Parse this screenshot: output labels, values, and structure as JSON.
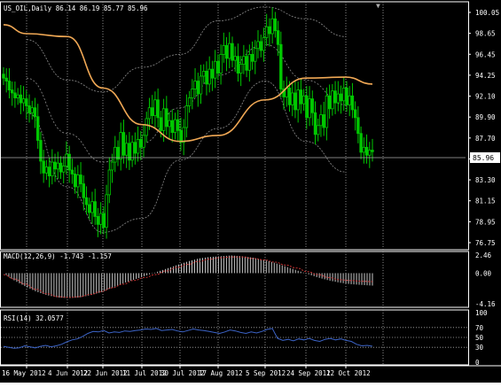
{
  "symbol_header": "US_OIL,Daily  86.14 86.19 85.77 85.96",
  "colors": {
    "background": "#000000",
    "frame": "#ffffff",
    "bull": "#00c800",
    "bear": "#00c800",
    "ma": "#f0a855",
    "bands": "#8c8c8c",
    "grid": "#aaaaaa",
    "macd_hist": "#c8c8c8",
    "macd_signal": "#c83232",
    "rsi": "#3c64c8",
    "text": "#ffffff",
    "price_tag_bg": "#ffffff",
    "price_tag_text": "#000000"
  },
  "price_axis_labels": [
    "100.05",
    "98.65",
    "96.45",
    "94.25",
    "92.10",
    "89.90",
    "87.70",
    "85.50",
    "83.30",
    "81.15",
    "78.95",
    "76.75"
  ],
  "current_price_tag": "85.96",
  "macd_title": "MACD(12,26,9) -1.743 -1.157",
  "macd_axis_labels": [
    "2.46",
    "0.00",
    "-4.16"
  ],
  "rsi_title": "RSI(14) 32.0577",
  "rsi_axis_labels": [
    "100",
    "70",
    "50",
    "30",
    "0"
  ],
  "date_labels": [
    "16 May 2012",
    "4 Jun 2012",
    "22 Jun 2012",
    "11 Jul 2012",
    "30 Jul 2012",
    "17 Aug 2012",
    "5 Sep 2012",
    "24 Sep 2012",
    "12 Oct 2012"
  ],
  "chart_data": [
    {
      "type": "candlestick",
      "title": "US_OIL,Daily",
      "ohlc_last": {
        "open": 86.14,
        "high": 86.19,
        "low": 85.77,
        "close": 85.96
      },
      "ylim": [
        76.75,
        100.05
      ],
      "x_tick_labels": [
        "16 May 2012",
        "4 Jun 2012",
        "22 Jun 2012",
        "11 Jul 2012",
        "30 Jul 2012",
        "17 Aug 2012",
        "5 Sep 2012",
        "24 Sep 2012",
        "12 Oct 2012"
      ],
      "close_series": [
        93.4,
        93.1,
        92.2,
        91.9,
        91.4,
        91.7,
        90.9,
        91.3,
        90.6,
        89.9,
        90.4,
        89.5,
        87.1,
        85.0,
        83.8,
        84.4,
        83.5,
        84.9,
        84.2,
        84.8,
        83.9,
        84.5,
        85.7,
        84.1,
        83.7,
        82.4,
        83.6,
        82.7,
        81.3,
        80.6,
        79.8,
        80.9,
        79.4,
        78.6,
        79.7,
        78.3,
        81.6,
        84.1,
        84.9,
        86.4,
        85.2,
        87.9,
        85.6,
        86.8,
        85.1,
        86.9,
        85.8,
        87.2,
        86.4,
        87.6,
        89.3,
        90.4,
        89.6,
        91.2,
        89.4,
        88.1,
        90.3,
        88.5,
        89.1,
        87.9,
        89.2,
        88.1,
        86.9,
        88.4,
        90.6,
        91.4,
        92.3,
        93.1,
        91.8,
        93.6,
        94.1,
        92.8,
        94.3,
        93.4,
        95.1,
        93.9,
        95.8,
        96.7,
        95.4,
        96.9,
        95.2,
        95.6,
        93.9,
        94.8,
        95.6,
        94.2,
        95.8,
        95.1,
        96.4,
        97.1,
        96.2,
        97.5,
        98.6,
        97.9,
        99.4,
        98.2,
        96.8,
        92.3,
        91.5,
        92.4,
        90.7,
        91.9,
        90.2,
        92.2,
        90.8,
        91.6,
        89.4,
        91.3,
        89.9,
        87.7,
        88.6,
        89.7,
        88.4,
        91.6,
        90.3,
        92.1,
        90.9,
        91.8,
        91.1,
        92.4,
        90.7,
        91.6,
        90.2,
        89.4,
        87.8,
        85.9,
        86.4,
        85.6,
        86.1,
        85.96
      ],
      "moving_average_level_at_ticks": [
        97.9,
        97.6,
        92.4,
        88.7,
        87.0,
        87.6,
        91.2,
        93.4,
        93.5
      ],
      "series": [
        {
          "values_at_ticks": [
            93.4,
            86.0,
            80.5,
            85.2,
            87.8,
            94.0,
            97.5,
            91.0,
            89.5
          ]
        },
        {
          "values_at_ticks": [
            97.9,
            97.6,
            92.4,
            88.7,
            87.0,
            87.6,
            91.2,
            93.4,
            93.5
          ]
        }
      ]
    },
    {
      "type": "bar",
      "title": "MACD(12,26,9) -1.743 -1.157",
      "ylim": [
        -4.16,
        2.46
      ],
      "histogram_values": [
        0.0,
        -1.0,
        -1.8,
        -2.5,
        -3.0,
        -3.3,
        -3.4,
        -3.3,
        -3.0,
        -2.6,
        -2.0,
        -1.4,
        -0.9,
        -0.4,
        0.1,
        0.6,
        1.1,
        1.6,
        2.0,
        2.2,
        2.3,
        2.4,
        2.3,
        2.1,
        1.8,
        1.4,
        0.9,
        0.4,
        -0.1,
        -0.6,
        -1.0,
        -1.3,
        -1.5,
        -1.6,
        -1.7
      ],
      "signal_values": [
        -0.2,
        -0.8,
        -1.5,
        -2.2,
        -2.8,
        -3.2,
        -3.3,
        -3.2,
        -2.9,
        -2.5,
        -2.0,
        -1.5,
        -1.0,
        -0.6,
        -0.2,
        0.3,
        0.8,
        1.2,
        1.6,
        1.9,
        2.1,
        2.2,
        2.2,
        2.0,
        1.8,
        1.5,
        1.1,
        0.7,
        0.2,
        -0.2,
        -0.6,
        -0.9,
        -1.0,
        -1.1,
        -1.157
      ]
    },
    {
      "type": "line",
      "title": "RSI(14) 32.0577",
      "ylim": [
        0,
        100
      ],
      "levels": [
        70,
        50,
        30
      ],
      "values": [
        32,
        30,
        28,
        29,
        33,
        31,
        29,
        32,
        34,
        31,
        33,
        36,
        41,
        45,
        47,
        52,
        58,
        62,
        61,
        64,
        59,
        61,
        60,
        63,
        62,
        64,
        65,
        67,
        66,
        68,
        64,
        65,
        66,
        63,
        61,
        64,
        67,
        65,
        64,
        62,
        60,
        58,
        61,
        65,
        63,
        60,
        58,
        61,
        59,
        62,
        66,
        68,
        48,
        44,
        46,
        43,
        47,
        45,
        48,
        44,
        42,
        46,
        48,
        45,
        47,
        44,
        42,
        36,
        33,
        34,
        32.06
      ]
    }
  ]
}
